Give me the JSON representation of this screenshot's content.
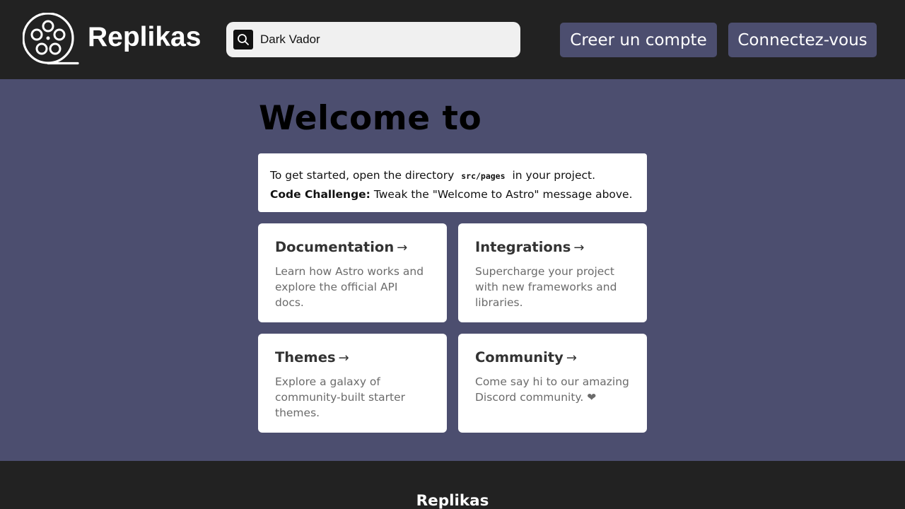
{
  "brand": {
    "name": "Replikas",
    "logo_icon": "film-reel-icon"
  },
  "search": {
    "value": "Dark Vador",
    "placeholder": "",
    "icon": "search-icon"
  },
  "header": {
    "register_label": "Creer un compte",
    "login_label": "Connectez-vous"
  },
  "main": {
    "title": "Welcome to",
    "instructions": {
      "line1_before": "To get started, open the directory",
      "line1_code": "src/pages",
      "line1_after": "in your project.",
      "line2_label": "Code Challenge:",
      "line2_text": "Tweak the \"Welcome to Astro\" message above."
    },
    "cards": [
      {
        "title": "Documentation",
        "arrow": "→",
        "description": "Learn how Astro works and explore the official API docs."
      },
      {
        "title": "Integrations",
        "arrow": "→",
        "description": "Supercharge your project with new frameworks and libraries."
      },
      {
        "title": "Themes",
        "arrow": "→",
        "description": "Explore a galaxy of community-built starter themes."
      },
      {
        "title": "Community",
        "arrow": "→",
        "description": "Come say hi to our amazing Discord community. ❤"
      }
    ]
  },
  "footer": {
    "title": "Replikas"
  },
  "colors": {
    "header_bg": "#222222",
    "page_bg": "#4c4e6f",
    "button_bg": "#4c4e6f",
    "card_bg": "#ffffff"
  }
}
